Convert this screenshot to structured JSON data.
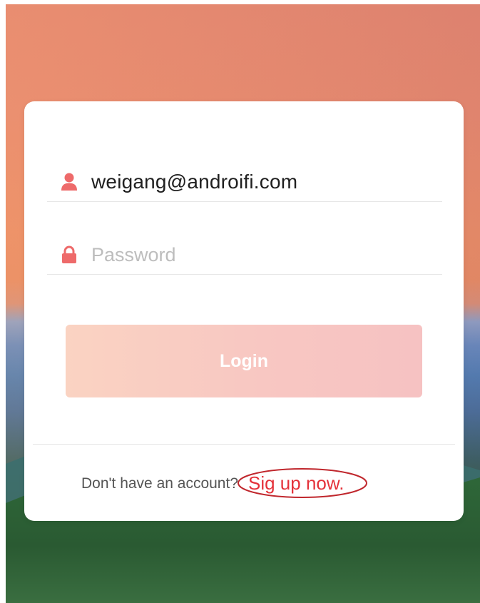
{
  "login_form": {
    "email_value": "weigang@androifi.com",
    "password_placeholder": "Password",
    "login_label": "Login",
    "signup_prompt": "Don't have an account?",
    "signup_link_label": "Sig up now."
  },
  "icons": {
    "email_icon": "user-icon",
    "password_icon": "lock-icon"
  },
  "colors": {
    "accent": "#ee6a6a",
    "link": "#e4323a",
    "annotation": "#c0272d",
    "login_gradient_start": "#fad3c2",
    "login_gradient_end": "#f6c2c2"
  }
}
